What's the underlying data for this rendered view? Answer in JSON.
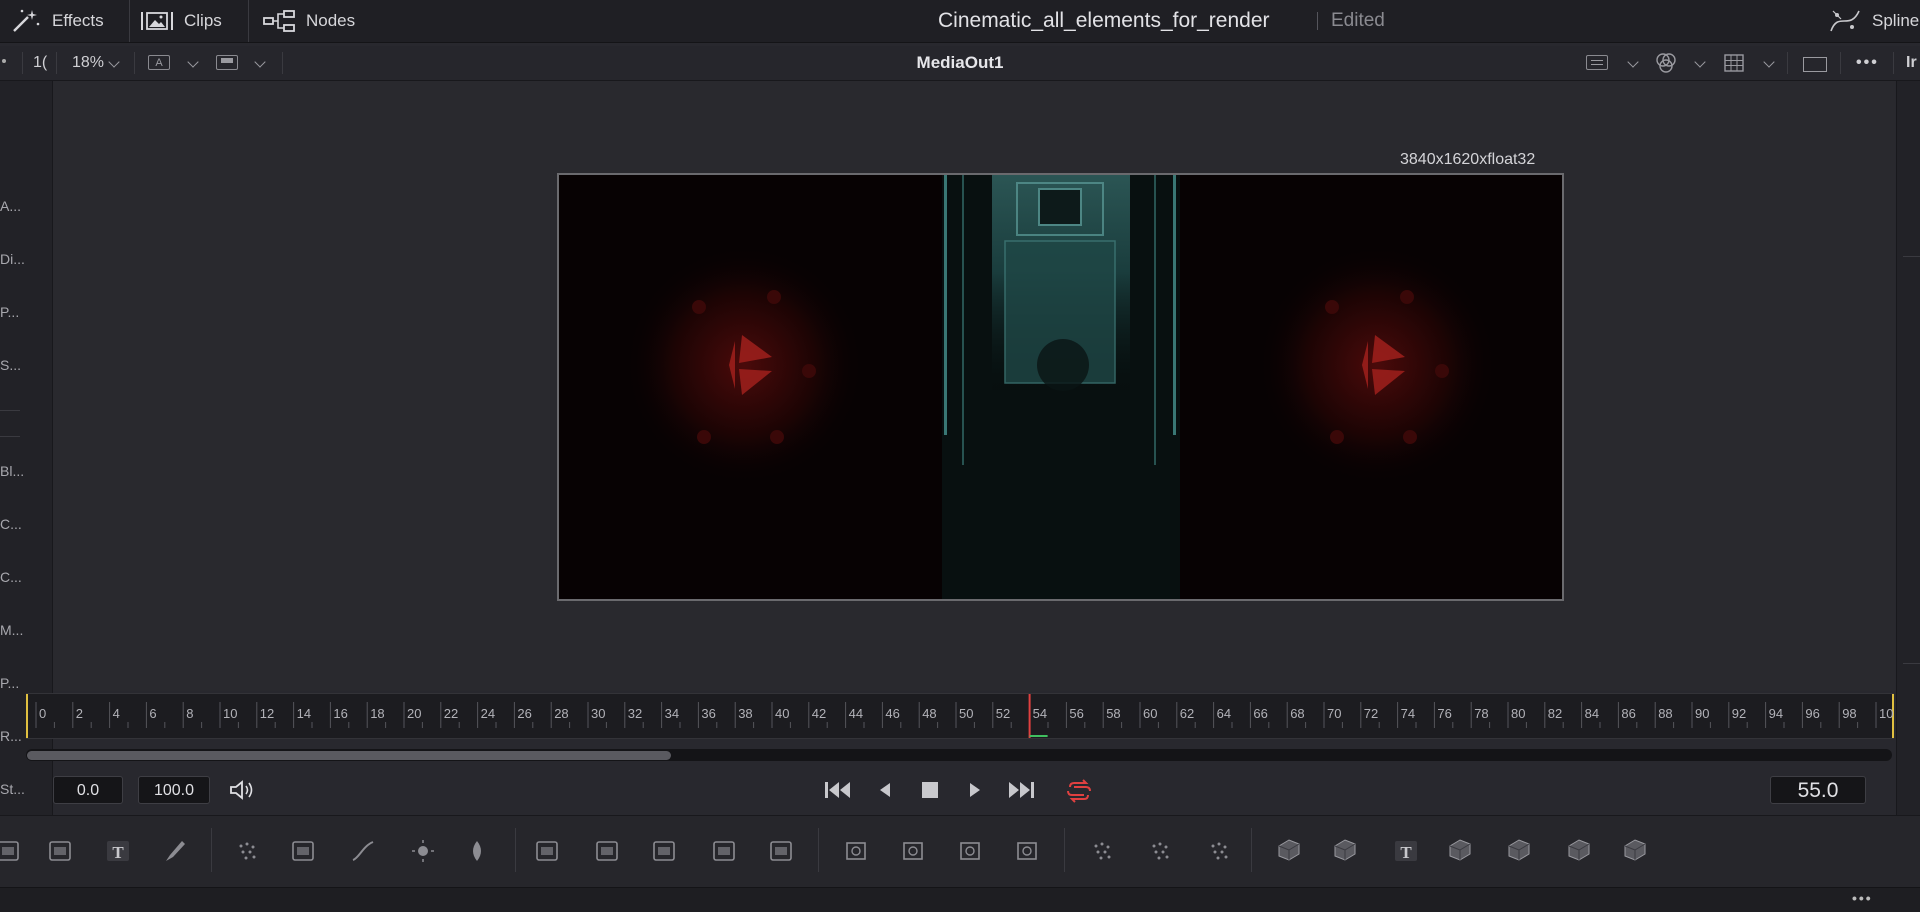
{
  "topbar": {
    "effects_label": "Effects",
    "clips_label": "Clips",
    "nodes_label": "Nodes",
    "project_title": "Cinematic_all_elements_for_render",
    "project_status": "Edited",
    "spline_label": "Spline"
  },
  "viewer_header": {
    "left_value": "1(",
    "zoom": "18%",
    "title": "MediaOut1",
    "right_cut_label": "Ir"
  },
  "viewer": {
    "resolution": "3840x1620xfloat32"
  },
  "left_strip": [
    "A...",
    "Di...",
    "P...",
    "S...",
    "Bl...",
    "C...",
    "C...",
    "M...",
    "P...",
    "R...",
    "St..."
  ],
  "timeline": {
    "tick_labels": [
      "0",
      "2",
      "4",
      "6",
      "8",
      "10",
      "12",
      "14",
      "16",
      "18",
      "20",
      "22",
      "24",
      "26",
      "28",
      "30",
      "32",
      "34",
      "36",
      "38",
      "40",
      "42",
      "44",
      "46",
      "48",
      "50",
      "52",
      "54",
      "56",
      "58",
      "60",
      "62",
      "64",
      "66",
      "68",
      "70",
      "72",
      "74",
      "76",
      "78",
      "80",
      "82",
      "84",
      "86",
      "88",
      "90",
      "92",
      "94",
      "96",
      "98",
      "10"
    ],
    "playhead": 54,
    "visible_start": 0,
    "visible_end": 100,
    "scroll_fraction": 0.345,
    "playhead_color": "#e04040",
    "loop_color": "#e04040"
  },
  "transport": {
    "start_time": "0.0",
    "end_time": "100.0",
    "current_time": "55.0"
  },
  "toolbar_tools": [
    "image-icon",
    "background-icon",
    "text-icon",
    "paint-icon",
    "particles-icon",
    "color-correct-icon",
    "curves-icon",
    "brightness-icon",
    "matte-icon",
    "merge-icon",
    "channel-booleans-icon",
    "display-icon",
    "resize-icon",
    "transform-icon",
    "rectangle-mask-icon",
    "ellipse-mask-icon",
    "polygon-mask-icon",
    "bspline-mask-icon",
    "particle-emitter-icon",
    "particle-render-icon",
    "particle-system-icon",
    "shape3d-icon",
    "merge3d-icon",
    "text3d-icon",
    "camera3d-icon",
    "renderer3d-icon",
    "light3d-icon",
    "environment3d-icon"
  ]
}
